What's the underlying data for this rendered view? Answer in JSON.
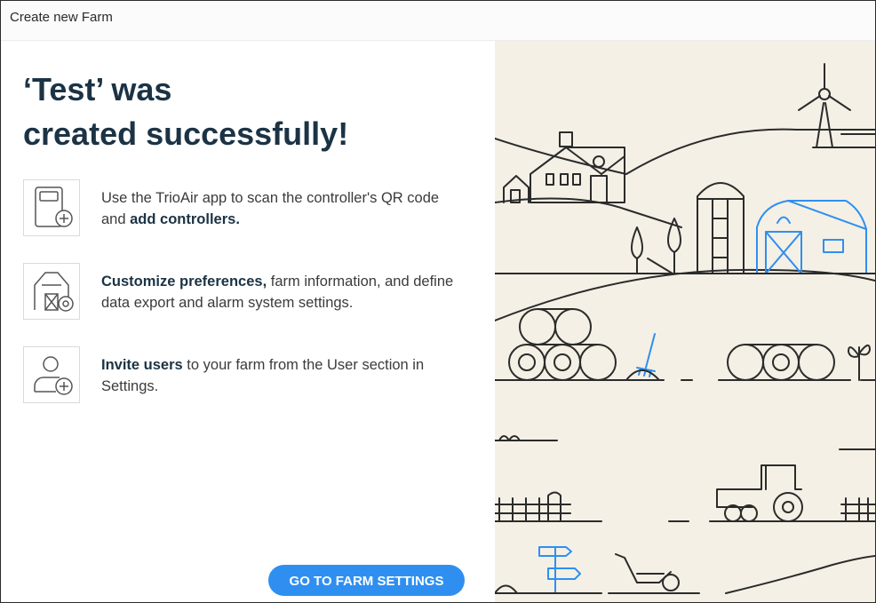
{
  "dialog": {
    "title": "Create new Farm"
  },
  "success": {
    "headline_line1": "‘Test’ was",
    "headline_line2": "created successfully!"
  },
  "steps": [
    {
      "icon": "controller-add-icon",
      "pre": "Use the TrioAir app to scan the controller's QR code and ",
      "bold": "add controllers.",
      "post": ""
    },
    {
      "icon": "barn-settings-icon",
      "pre": "",
      "bold": "Customize preferences,",
      "post": " farm information, and define data export and alarm system settings."
    },
    {
      "icon": "user-add-icon",
      "pre": "",
      "bold": "Invite users",
      "post": " to your farm from the User section in Settings."
    }
  ],
  "actions": {
    "go_to_settings": "GO TO FARM SETTINGS"
  },
  "colors": {
    "heading": "#1b3345",
    "accent": "#2f8ff0",
    "illustration_bg": "#f4f0e6",
    "illustration_line": "#2b2b2b",
    "illustration_accent": "#2f8ff0"
  }
}
